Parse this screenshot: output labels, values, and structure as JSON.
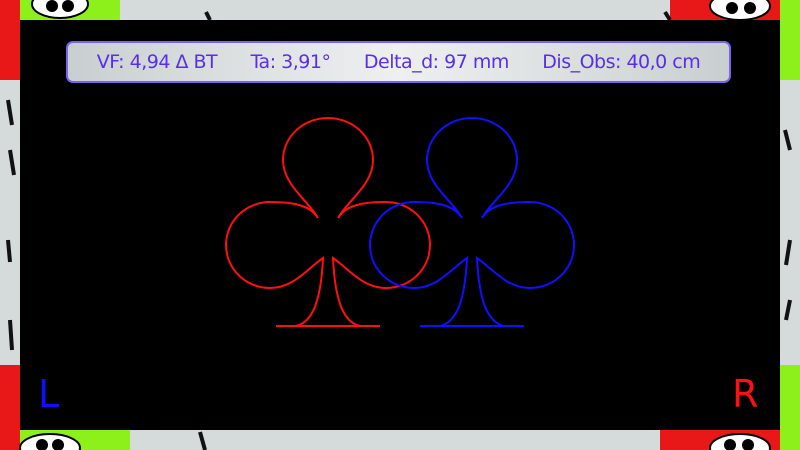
{
  "info_bar": {
    "vf": "VF: 4,94 Δ BT",
    "ta": "Ta: 3,91°",
    "delta_d": "Delta_d: 97 mm",
    "dis_obs": "Dis_Obs: 40,0 cm"
  },
  "stimulus": {
    "left_club_color": "#ff1010",
    "right_club_color": "#1010ff"
  },
  "eye_labels": {
    "left": "L",
    "right": "R",
    "left_color": "#1010ff",
    "right_color": "#ff1010"
  }
}
